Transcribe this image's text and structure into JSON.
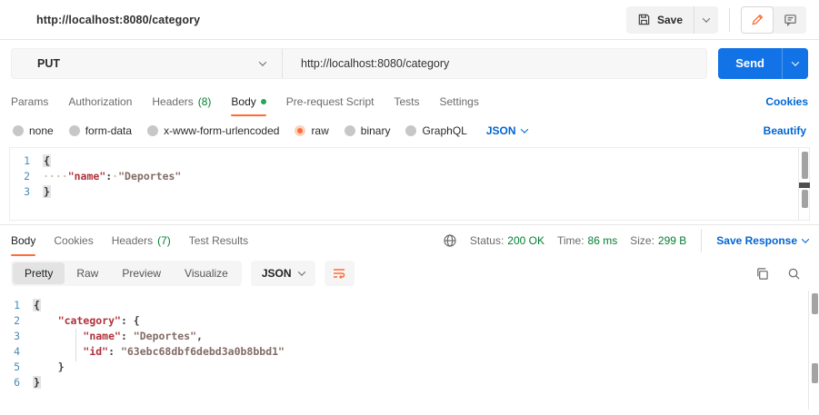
{
  "colors": {
    "accent_orange": "#FF6C37",
    "link_blue": "#0265D2",
    "send_blue": "#1273E6",
    "success_green": "#007F31"
  },
  "icons": {
    "save": "floppy-disk",
    "edit": "pencil",
    "comment": "speech-bubble",
    "globe": "globe",
    "wrap": "text-wrap",
    "copy": "overlapping-squares",
    "search": "magnifier",
    "dropdown": "chevron-down"
  },
  "topbar": {
    "url": "http://localhost:8080/category",
    "save_label": "Save"
  },
  "request": {
    "method": "PUT",
    "url": "http://localhost:8080/category",
    "send_label": "Send",
    "cookies_link": "Cookies",
    "beautify_link": "Beautify",
    "tabs": {
      "params": "Params",
      "authorization": "Authorization",
      "headers": "Headers",
      "headers_count": "(8)",
      "body": "Body",
      "prerequest": "Pre-request Script",
      "tests": "Tests",
      "settings": "Settings"
    },
    "body_types": {
      "none": "none",
      "form_data": "form-data",
      "urlencoded": "x-www-form-urlencoded",
      "raw": "raw",
      "binary": "binary",
      "graphql": "GraphQL"
    },
    "selected_body_type": "raw",
    "language": "JSON",
    "editor": {
      "lines": [
        {
          "num": "1",
          "tokens": [
            {
              "type": "brace-hl",
              "text": "{"
            }
          ]
        },
        {
          "num": "2",
          "tokens": [
            {
              "type": "ws",
              "text": "····"
            },
            {
              "type": "key",
              "text": "\"name\""
            },
            {
              "type": "punc",
              "text": ":"
            },
            {
              "type": "ws",
              "text": "·"
            },
            {
              "type": "str",
              "text": "\"Deportes\""
            }
          ]
        },
        {
          "num": "3",
          "tokens": [
            {
              "type": "brace-hl",
              "text": "}"
            }
          ]
        }
      ]
    }
  },
  "response": {
    "tabs": {
      "body": "Body",
      "cookies": "Cookies",
      "headers": "Headers",
      "headers_count": "(7)",
      "test_results": "Test Results"
    },
    "meta": {
      "status_label": "Status:",
      "status_value": "200 OK",
      "time_label": "Time:",
      "time_value": "86 ms",
      "size_label": "Size:",
      "size_value": "299 B",
      "save_response_label": "Save Response"
    },
    "view_tabs": {
      "pretty": "Pretty",
      "raw": "Raw",
      "preview": "Preview",
      "visualize": "Visualize"
    },
    "language": "JSON",
    "editor": {
      "lines": [
        {
          "num": "1",
          "tokens": [
            {
              "type": "brace-hl",
              "text": "{"
            }
          ]
        },
        {
          "num": "2",
          "tokens": [
            {
              "type": "sp",
              "text": "    "
            },
            {
              "type": "key",
              "text": "\"category\""
            },
            {
              "type": "punc",
              "text": ": {"
            }
          ]
        },
        {
          "num": "3",
          "tokens": [
            {
              "type": "sp",
              "text": "        "
            },
            {
              "type": "key",
              "text": "\"name\""
            },
            {
              "type": "punc",
              "text": ": "
            },
            {
              "type": "str",
              "text": "\"Deportes\""
            },
            {
              "type": "punc",
              "text": ","
            }
          ]
        },
        {
          "num": "4",
          "tokens": [
            {
              "type": "sp",
              "text": "        "
            },
            {
              "type": "key",
              "text": "\"id\""
            },
            {
              "type": "punc",
              "text": ": "
            },
            {
              "type": "str",
              "text": "\"63ebc68dbf6debd3a0b8bbd1\""
            }
          ]
        },
        {
          "num": "5",
          "tokens": [
            {
              "type": "sp",
              "text": "    "
            },
            {
              "type": "punc",
              "text": "}"
            }
          ]
        },
        {
          "num": "6",
          "tokens": [
            {
              "type": "brace-hl",
              "text": "}"
            }
          ]
        }
      ]
    }
  }
}
